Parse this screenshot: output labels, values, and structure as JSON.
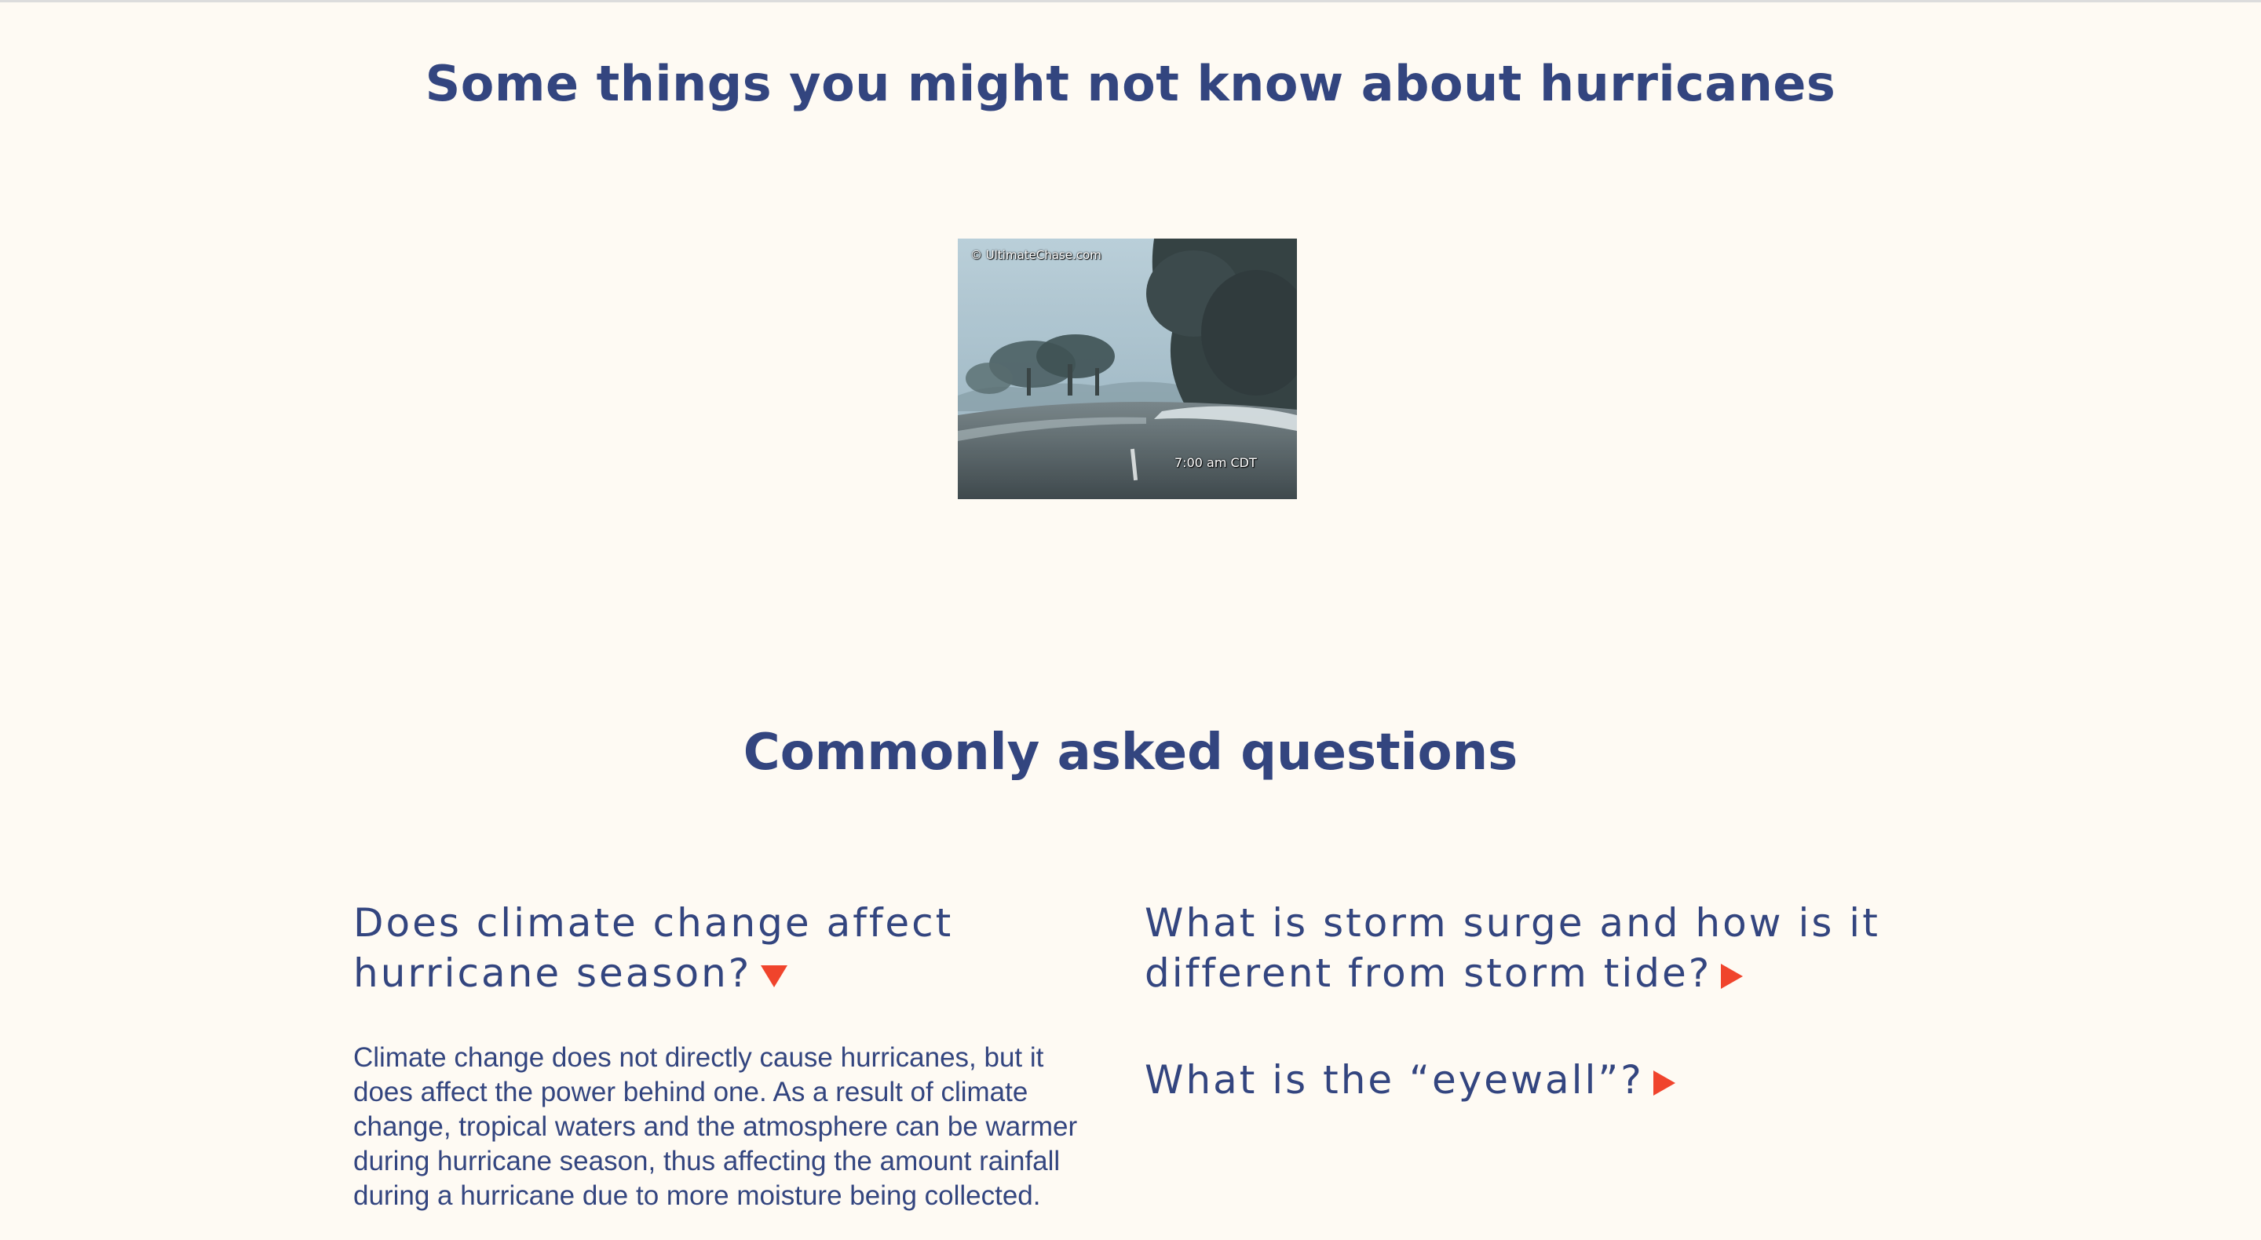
{
  "hero": {
    "title": "Some things you might not know about hurricanes"
  },
  "media": {
    "watermark": "© UltimateChase.com",
    "timestamp": "7:00 am CDT"
  },
  "faq": {
    "title": "Commonly asked questions",
    "items": [
      {
        "question": "Does climate change affect hurricane season?",
        "expanded": true,
        "answer": "Climate change does not directly cause hurricanes, but it does affect the power behind one. As a result of climate change, tropical waters and the atmosphere can be warmer during hurricane season, thus affecting the amount rainfall during a hurricane due to more moisture being collected."
      },
      {
        "question": "What is storm surge and how is it different from storm tide?",
        "expanded": false
      },
      {
        "question": "What is the “eyewall”?",
        "expanded": false
      }
    ],
    "arrow_color": "#f0442c"
  },
  "colors": {
    "background": "#fefaf3",
    "text": "#33457f",
    "accent": "#f0442c"
  }
}
